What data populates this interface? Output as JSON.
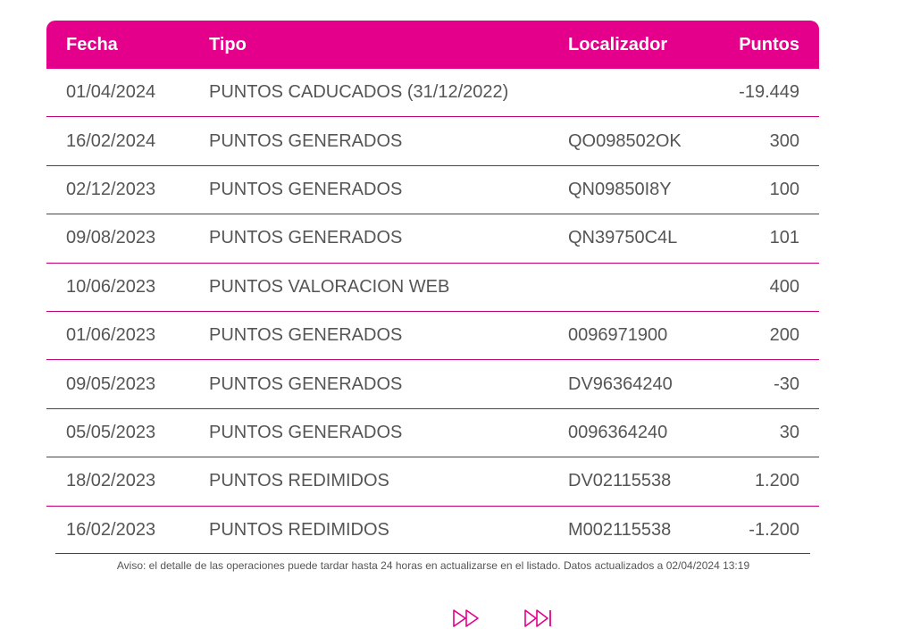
{
  "table": {
    "headers": {
      "fecha": "Fecha",
      "tipo": "Tipo",
      "localizador": "Localizador",
      "puntos": "Puntos"
    },
    "rows": [
      {
        "fecha": "01/04/2024",
        "tipo": "PUNTOS CADUCADOS (31/12/2022)",
        "localizador": "",
        "puntos": "-19.449"
      },
      {
        "fecha": "16/02/2024",
        "tipo": "PUNTOS GENERADOS",
        "localizador": "QO098502OK",
        "puntos": "300"
      },
      {
        "fecha": "02/12/2023",
        "tipo": "PUNTOS GENERADOS",
        "localizador": "QN09850I8Y",
        "puntos": "100"
      },
      {
        "fecha": "09/08/2023",
        "tipo": "PUNTOS GENERADOS",
        "localizador": "QN39750C4L",
        "puntos": "101"
      },
      {
        "fecha": "10/06/2023",
        "tipo": "PUNTOS VALORACION WEB",
        "localizador": "",
        "puntos": "400"
      },
      {
        "fecha": "01/06/2023",
        "tipo": "PUNTOS GENERADOS",
        "localizador": "0096971900",
        "puntos": "200"
      },
      {
        "fecha": "09/05/2023",
        "tipo": "PUNTOS GENERADOS",
        "localizador": "DV96364240",
        "puntos": "-30"
      },
      {
        "fecha": "05/05/2023",
        "tipo": "PUNTOS GENERADOS",
        "localizador": "0096364240",
        "puntos": "30"
      },
      {
        "fecha": "18/02/2023",
        "tipo": "PUNTOS REDIMIDOS",
        "localizador": "DV02115538",
        "puntos": "1.200"
      },
      {
        "fecha": "16/02/2023",
        "tipo": "PUNTOS REDIMIDOS",
        "localizador": "M002115538",
        "puntos": "-1.200"
      }
    ]
  },
  "notice": "Aviso: el detalle de las operaciones puede tardar hasta 24 horas en actualizarse en el listado. Datos actualizados a 02/04/2024 13:19",
  "pagination": {
    "next_icon": "double-chevron-right-icon",
    "last_icon": "skip-to-end-icon"
  },
  "colors": {
    "accent": "#e5008c",
    "divider": "#c2007a",
    "text": "#555555"
  }
}
